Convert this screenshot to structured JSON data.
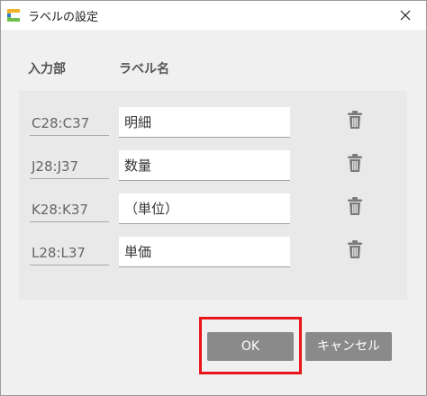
{
  "window": {
    "title": "ラベルの設定",
    "close_symbol": "✕"
  },
  "headers": {
    "input_part": "入力部",
    "label_name": "ラベル名"
  },
  "rows": [
    {
      "range": "C28:C37",
      "label": "明細"
    },
    {
      "range": "J28:J37",
      "label": "数量"
    },
    {
      "range": "K28:K37",
      "label": "（単位）"
    },
    {
      "range": "L28:L37",
      "label": "単価"
    }
  ],
  "buttons": {
    "ok": "OK",
    "cancel": "キャンセル"
  },
  "colors": {
    "button_bg": "#8a8a8a",
    "highlight": "#e8161b",
    "panel_bg": "#e9e9e9"
  }
}
